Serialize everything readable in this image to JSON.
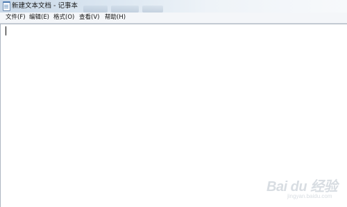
{
  "window": {
    "title": "新建文本文档 - 记事本",
    "app_icon": "notepad-icon"
  },
  "menubar": {
    "items": [
      {
        "label": "文件(F)"
      },
      {
        "label": "编辑(E)"
      },
      {
        "label": "格式(O)"
      },
      {
        "label": "查看(V)"
      },
      {
        "label": "帮助(H)"
      }
    ]
  },
  "editor": {
    "content": ""
  },
  "watermark": {
    "logo_text": "Bai du 经验",
    "url_text": "jingyan.baidu.com"
  }
}
